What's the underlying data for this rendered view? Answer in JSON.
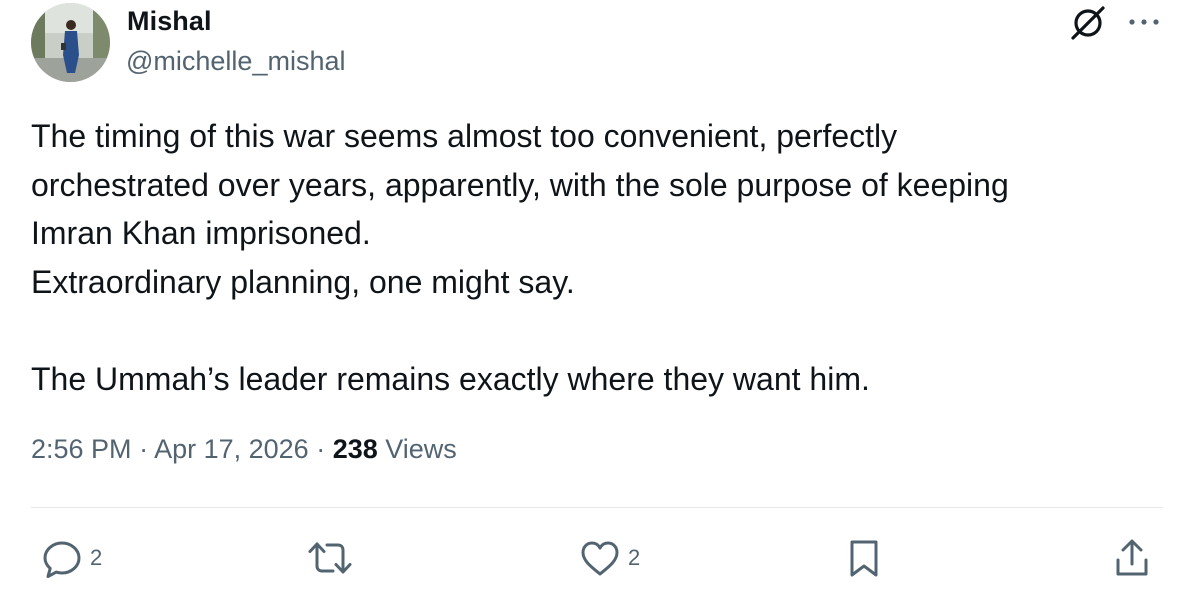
{
  "author": {
    "name": "Mishal",
    "handle": "@michelle_mishal",
    "avatar_icon": "avatar-photo"
  },
  "header_icons": {
    "grok": "grok-icon",
    "more": "more-icon"
  },
  "tweet": {
    "lines": [
      "The timing of this war seems almost too convenient, perfectly",
      "orchestrated over years, apparently, with the sole purpose of keeping",
      "Imran Khan imprisoned.",
      "Extraordinary planning, one might say.",
      "",
      "The Ummah’s leader remains exactly where they want him."
    ]
  },
  "meta": {
    "time": "2:56 PM",
    "separator": " · ",
    "date": "Apr 17, 2026",
    "views_count": "238",
    "views_label": " Views"
  },
  "actions": {
    "reply_count": "2",
    "repost_count": "",
    "like_count": "2",
    "bookmark_count": "",
    "share_count": ""
  },
  "colors": {
    "text_primary": "#0f1419",
    "text_secondary": "#536471",
    "divider": "#e7e9ea"
  }
}
